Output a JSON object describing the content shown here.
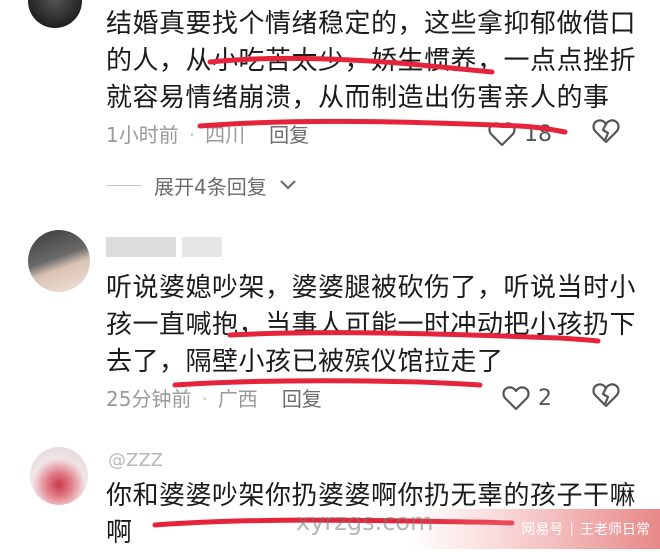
{
  "comments": [
    {
      "text": "结婚真要找个情绪稳定的，这些拿抑郁做借口的人，从小吃苦太少，娇生惯养，一点点挫折就容易情绪崩溃，从而制造出伤害亲人的事",
      "time": "1小时前",
      "location": "四川",
      "reply_label": "回复",
      "likes": "18",
      "expand_label": "展开4条回复"
    },
    {
      "text": "听说婆媳吵架，婆婆腿被砍伤了，听说当时小孩一直喊抱，当事人可能一时冲动把小孩扔下去了，隔壁小孩已被殡仪馆拉走了",
      "time": "25分钟前",
      "location": "广西",
      "reply_label": "回复",
      "likes": "2"
    },
    {
      "username": "ZZZ",
      "text": "你和婆婆吵架你扔婆婆啊你扔无辜的孩子干嘛啊"
    }
  ],
  "watermark": "xyrzgs.com",
  "brand": {
    "platform": "网易号",
    "author": "王老师日常"
  },
  "colors": {
    "annotation_red": "#e5233b",
    "meta_gray": "#9a9a9a"
  }
}
